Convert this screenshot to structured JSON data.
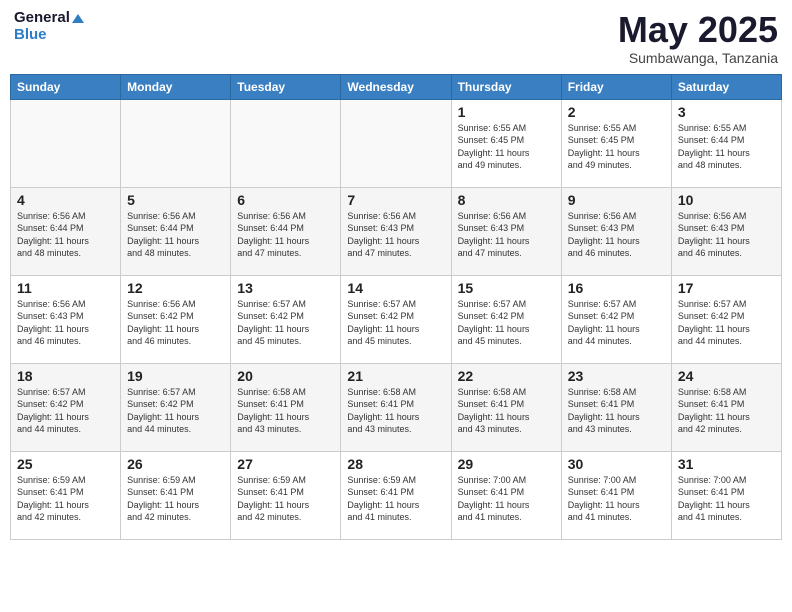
{
  "header": {
    "logo_line1": "General",
    "logo_line2": "Blue",
    "month": "May 2025",
    "location": "Sumbawanga, Tanzania"
  },
  "weekdays": [
    "Sunday",
    "Monday",
    "Tuesday",
    "Wednesday",
    "Thursday",
    "Friday",
    "Saturday"
  ],
  "weeks": [
    [
      {
        "day": "",
        "info": ""
      },
      {
        "day": "",
        "info": ""
      },
      {
        "day": "",
        "info": ""
      },
      {
        "day": "",
        "info": ""
      },
      {
        "day": "1",
        "info": "Sunrise: 6:55 AM\nSunset: 6:45 PM\nDaylight: 11 hours\nand 49 minutes."
      },
      {
        "day": "2",
        "info": "Sunrise: 6:55 AM\nSunset: 6:45 PM\nDaylight: 11 hours\nand 49 minutes."
      },
      {
        "day": "3",
        "info": "Sunrise: 6:55 AM\nSunset: 6:44 PM\nDaylight: 11 hours\nand 48 minutes."
      }
    ],
    [
      {
        "day": "4",
        "info": "Sunrise: 6:56 AM\nSunset: 6:44 PM\nDaylight: 11 hours\nand 48 minutes."
      },
      {
        "day": "5",
        "info": "Sunrise: 6:56 AM\nSunset: 6:44 PM\nDaylight: 11 hours\nand 48 minutes."
      },
      {
        "day": "6",
        "info": "Sunrise: 6:56 AM\nSunset: 6:44 PM\nDaylight: 11 hours\nand 47 minutes."
      },
      {
        "day": "7",
        "info": "Sunrise: 6:56 AM\nSunset: 6:43 PM\nDaylight: 11 hours\nand 47 minutes."
      },
      {
        "day": "8",
        "info": "Sunrise: 6:56 AM\nSunset: 6:43 PM\nDaylight: 11 hours\nand 47 minutes."
      },
      {
        "day": "9",
        "info": "Sunrise: 6:56 AM\nSunset: 6:43 PM\nDaylight: 11 hours\nand 46 minutes."
      },
      {
        "day": "10",
        "info": "Sunrise: 6:56 AM\nSunset: 6:43 PM\nDaylight: 11 hours\nand 46 minutes."
      }
    ],
    [
      {
        "day": "11",
        "info": "Sunrise: 6:56 AM\nSunset: 6:43 PM\nDaylight: 11 hours\nand 46 minutes."
      },
      {
        "day": "12",
        "info": "Sunrise: 6:56 AM\nSunset: 6:42 PM\nDaylight: 11 hours\nand 46 minutes."
      },
      {
        "day": "13",
        "info": "Sunrise: 6:57 AM\nSunset: 6:42 PM\nDaylight: 11 hours\nand 45 minutes."
      },
      {
        "day": "14",
        "info": "Sunrise: 6:57 AM\nSunset: 6:42 PM\nDaylight: 11 hours\nand 45 minutes."
      },
      {
        "day": "15",
        "info": "Sunrise: 6:57 AM\nSunset: 6:42 PM\nDaylight: 11 hours\nand 45 minutes."
      },
      {
        "day": "16",
        "info": "Sunrise: 6:57 AM\nSunset: 6:42 PM\nDaylight: 11 hours\nand 44 minutes."
      },
      {
        "day": "17",
        "info": "Sunrise: 6:57 AM\nSunset: 6:42 PM\nDaylight: 11 hours\nand 44 minutes."
      }
    ],
    [
      {
        "day": "18",
        "info": "Sunrise: 6:57 AM\nSunset: 6:42 PM\nDaylight: 11 hours\nand 44 minutes."
      },
      {
        "day": "19",
        "info": "Sunrise: 6:57 AM\nSunset: 6:42 PM\nDaylight: 11 hours\nand 44 minutes."
      },
      {
        "day": "20",
        "info": "Sunrise: 6:58 AM\nSunset: 6:41 PM\nDaylight: 11 hours\nand 43 minutes."
      },
      {
        "day": "21",
        "info": "Sunrise: 6:58 AM\nSunset: 6:41 PM\nDaylight: 11 hours\nand 43 minutes."
      },
      {
        "day": "22",
        "info": "Sunrise: 6:58 AM\nSunset: 6:41 PM\nDaylight: 11 hours\nand 43 minutes."
      },
      {
        "day": "23",
        "info": "Sunrise: 6:58 AM\nSunset: 6:41 PM\nDaylight: 11 hours\nand 43 minutes."
      },
      {
        "day": "24",
        "info": "Sunrise: 6:58 AM\nSunset: 6:41 PM\nDaylight: 11 hours\nand 42 minutes."
      }
    ],
    [
      {
        "day": "25",
        "info": "Sunrise: 6:59 AM\nSunset: 6:41 PM\nDaylight: 11 hours\nand 42 minutes."
      },
      {
        "day": "26",
        "info": "Sunrise: 6:59 AM\nSunset: 6:41 PM\nDaylight: 11 hours\nand 42 minutes."
      },
      {
        "day": "27",
        "info": "Sunrise: 6:59 AM\nSunset: 6:41 PM\nDaylight: 11 hours\nand 42 minutes."
      },
      {
        "day": "28",
        "info": "Sunrise: 6:59 AM\nSunset: 6:41 PM\nDaylight: 11 hours\nand 41 minutes."
      },
      {
        "day": "29",
        "info": "Sunrise: 7:00 AM\nSunset: 6:41 PM\nDaylight: 11 hours\nand 41 minutes."
      },
      {
        "day": "30",
        "info": "Sunrise: 7:00 AM\nSunset: 6:41 PM\nDaylight: 11 hours\nand 41 minutes."
      },
      {
        "day": "31",
        "info": "Sunrise: 7:00 AM\nSunset: 6:41 PM\nDaylight: 11 hours\nand 41 minutes."
      }
    ]
  ]
}
